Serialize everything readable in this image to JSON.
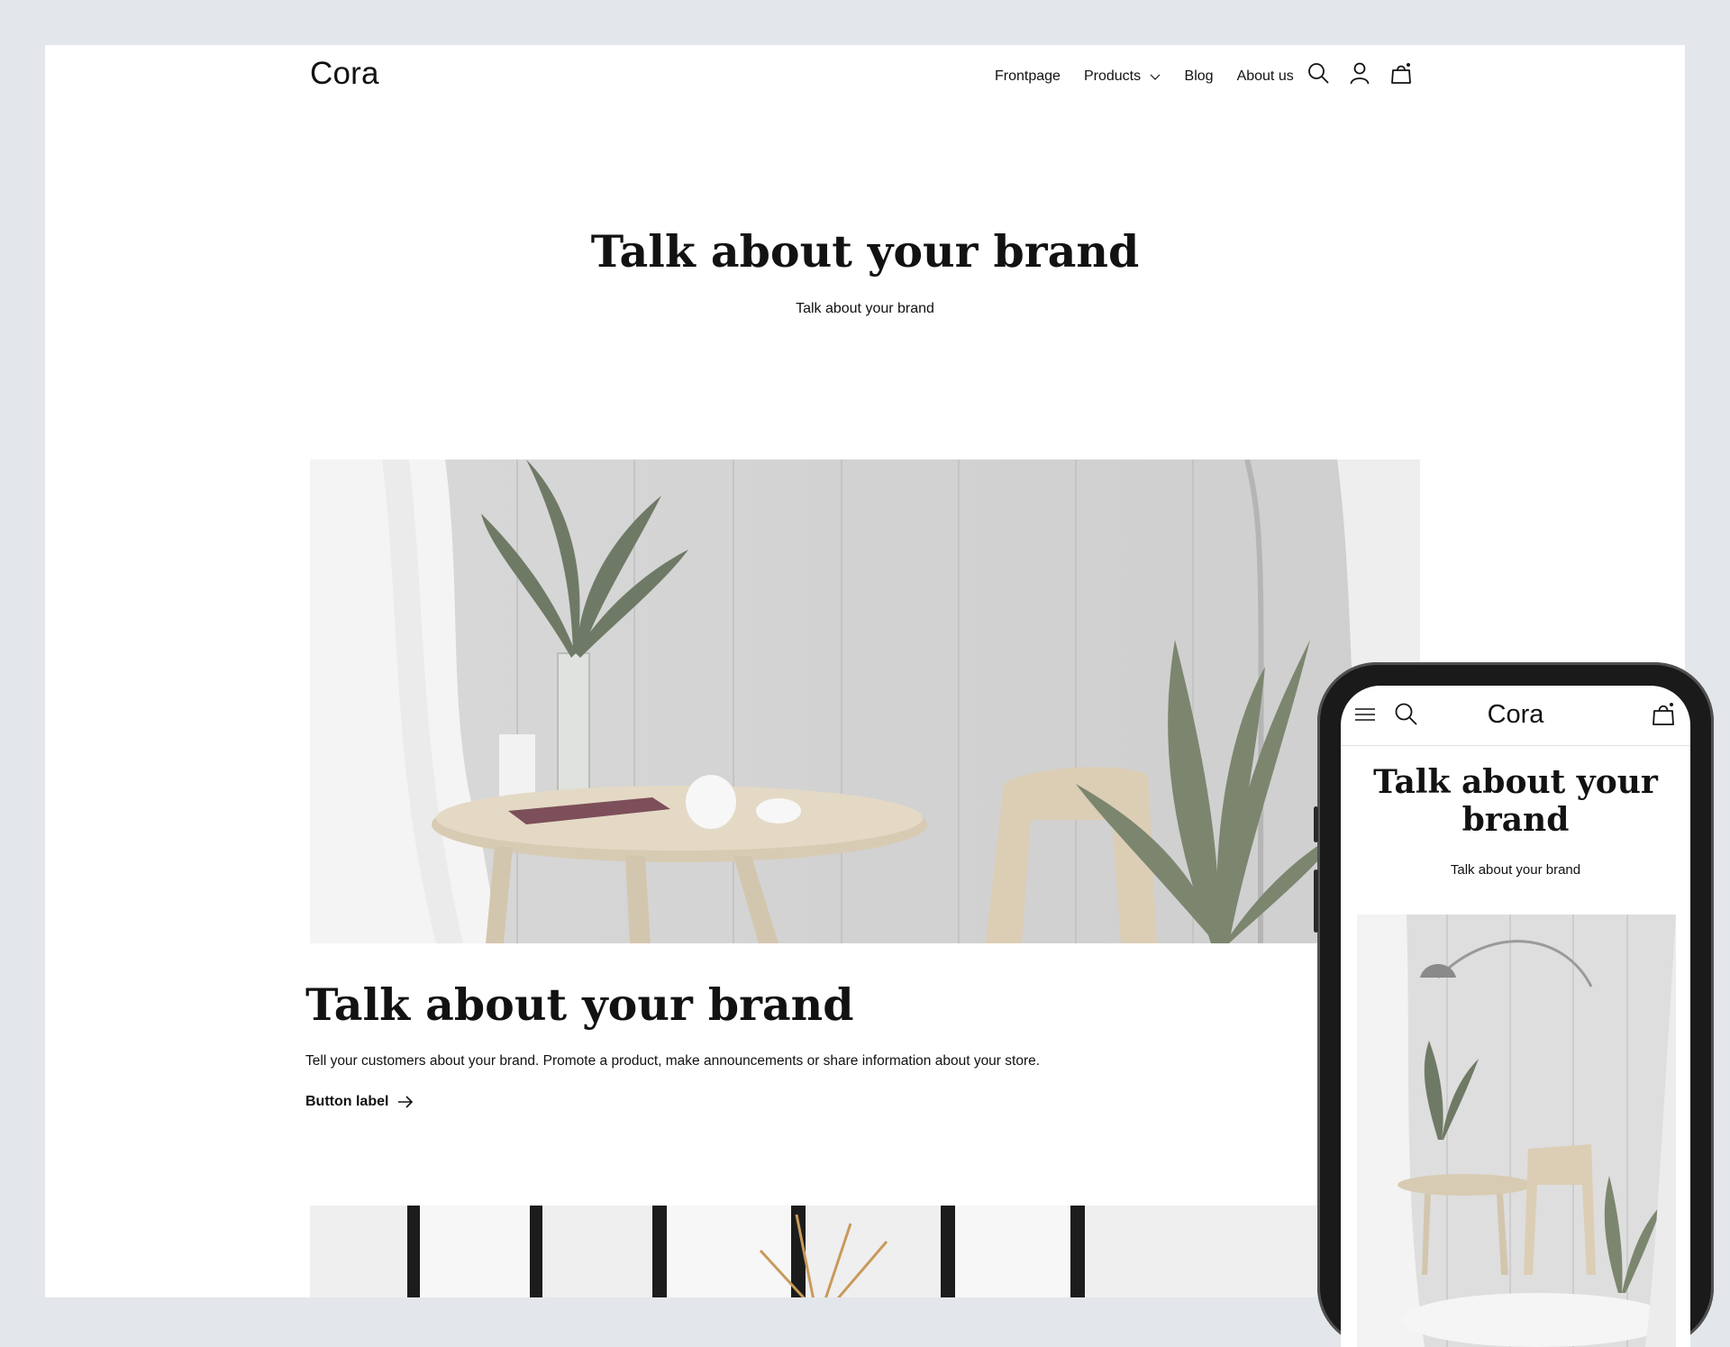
{
  "desktop": {
    "logo": "Cora",
    "nav": {
      "frontpage": "Frontpage",
      "products": "Products",
      "blog": "Blog",
      "about": "About us"
    },
    "icons": [
      "search-icon",
      "account-icon",
      "cart-icon"
    ],
    "hero": {
      "title": "Talk about your brand",
      "subtitle": "Talk about your brand"
    },
    "feature": {
      "title": "Talk about your brand",
      "text": "Tell your customers about your brand. Promote a product, make announcements or share information about your store.",
      "button_label": "Button label"
    }
  },
  "mobile": {
    "logo": "Cora",
    "icons": [
      "menu-icon",
      "search-icon",
      "cart-icon"
    ],
    "hero": {
      "title": "Talk about your brand",
      "subtitle": "Talk about your brand"
    }
  },
  "colors": {
    "background": "#e3e6ea",
    "text": "#121212",
    "page": "#ffffff"
  }
}
